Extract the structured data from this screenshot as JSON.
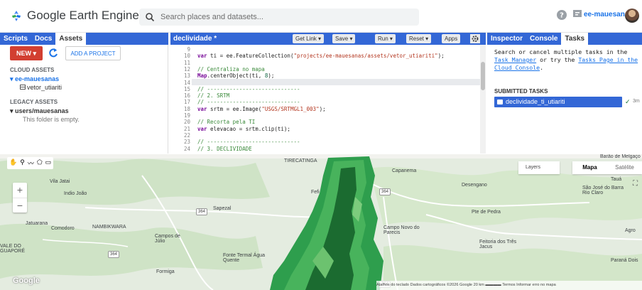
{
  "header": {
    "app_name": "Google Earth Engine",
    "search_placeholder": "Search places and datasets...",
    "account": "ee-mauesanas"
  },
  "left_panel": {
    "tabs": [
      "Scripts",
      "Docs",
      "Assets"
    ],
    "active_tab": "Assets",
    "new_label": "NEW",
    "add_project_label": "ADD A PROJECT",
    "cloud_assets_label": "CLOUD ASSETS",
    "project_name": "ee-mauesanas",
    "asset_name": "vetor_utiariti",
    "legacy_assets_label": "LEGACY ASSETS",
    "legacy_user": "users/mauesanas",
    "empty_folder": "This folder is empty."
  },
  "editor": {
    "script_name": "declividade *",
    "buttons": [
      "Get Link",
      "Save",
      "Run",
      "Reset",
      "Apps"
    ],
    "lines": [
      {
        "n": "9",
        "html": ""
      },
      {
        "n": "10",
        "html": "var ti = ee.FeatureCollection(\"projects/ee-mauesanas/assets/vetor_utiariti\");"
      },
      {
        "n": "11",
        "html": ""
      },
      {
        "n": "12",
        "html": "// Centraliza no mapa"
      },
      {
        "n": "13",
        "html": "Map.centerObject(ti, 8);"
      },
      {
        "n": "14",
        "html": ""
      },
      {
        "n": "15",
        "html": "// -----------------------------"
      },
      {
        "n": "16",
        "html": "// 2. SRTM"
      },
      {
        "n": "17",
        "html": "// -----------------------------"
      },
      {
        "n": "18",
        "html": "var srtm = ee.Image(\"USGS/SRTMGL1_003\");"
      },
      {
        "n": "19",
        "html": ""
      },
      {
        "n": "20",
        "html": "// Recorta pela TI"
      },
      {
        "n": "21",
        "html": "var elevacao = srtm.clip(ti);"
      },
      {
        "n": "22",
        "html": ""
      },
      {
        "n": "23",
        "html": "// -----------------------------"
      },
      {
        "n": "24",
        "html": "// 3. DECLIVIDADE"
      }
    ]
  },
  "right_panel": {
    "tabs": [
      "Inspector",
      "Console",
      "Tasks"
    ],
    "active_tab": "Tasks",
    "desc_prefix": "Search or cancel multiple tasks in the ",
    "task_manager_link": "Task Manager",
    "desc_mid": " or try the ",
    "tasks_page_link": "Tasks Page in the Cloud Console",
    "desc_suffix": ".",
    "submitted_label": "SUBMITTED TASKS",
    "task_name": "declividade_ti_utiariti",
    "task_time": "3m"
  },
  "map": {
    "labels": [
      "Vila Jatai",
      "Indio João",
      "Jatuarana",
      "Comodoro",
      "NAMBIKWARA",
      "VALE DO GUAPORÉ",
      "Campos de Júlio",
      "Sapezal",
      "Fonte Termal Água Quente",
      "Formiga",
      "TIRECATINGA",
      "Capanema",
      "Desengano",
      "Pte de Pedra",
      "Campo Novo do Parecis",
      "Fefi",
      "Feitoria dos Três Jacus",
      "São José do Barra Rio Claro",
      "Tauá",
      "Agro",
      "Paraná Dois",
      "Barão de Melgaço"
    ],
    "shields": [
      "364",
      "364",
      "364",
      "364"
    ],
    "layers_label": "Layers",
    "map_types": [
      "Mapa",
      "Satélite"
    ],
    "active_map_type": "Mapa",
    "footer": "Atalhos do teclado   Dados cartográficos ©2026 Google   20 km ▬▬▬▬   Termos   Informar erro no mapa",
    "google_logo": "Google"
  },
  "colors": {
    "blue": "#3367d6",
    "red": "#d23f31",
    "terrain_green": "#2e9e4d",
    "terrain_dark": "#1b6b30"
  }
}
